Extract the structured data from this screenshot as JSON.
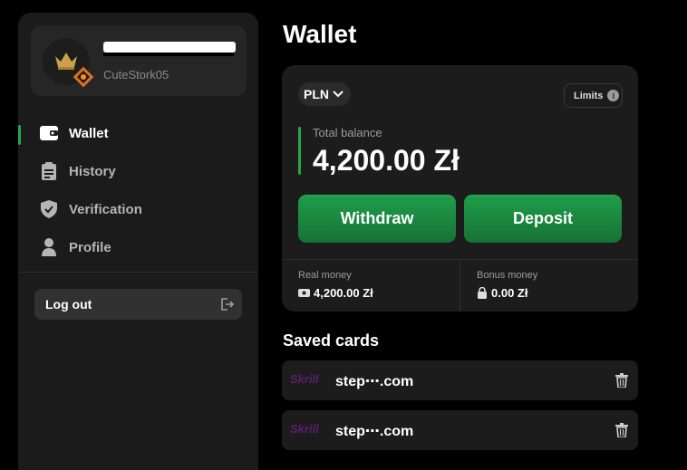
{
  "sidebar": {
    "profile": {
      "handle": "CuteStork05"
    },
    "items": [
      {
        "label": "Wallet",
        "icon": "wallet-icon",
        "active": true
      },
      {
        "label": "History",
        "icon": "clipboard-icon",
        "active": false
      },
      {
        "label": "Verification",
        "icon": "shield-check-icon",
        "active": false
      },
      {
        "label": "Profile",
        "icon": "user-icon",
        "active": false
      }
    ],
    "logout_label": "Log out"
  },
  "main": {
    "title": "Wallet",
    "currency": "PLN",
    "limits_label": "Limits",
    "balance_label": "Total balance",
    "balance_value": "4,200.00 Zł",
    "withdraw_label": "Withdraw",
    "deposit_label": "Deposit",
    "real_money_label": "Real money",
    "real_money_value": "4,200.00 Zł",
    "bonus_money_label": "Bonus money",
    "bonus_money_value": "0.00 Zł",
    "saved_cards_title": "Saved cards",
    "saved_cards": [
      {
        "brand": "Skrill",
        "email": "step⋯.com"
      },
      {
        "brand": "Skrill",
        "email": "step⋯.com"
      }
    ]
  },
  "colors": {
    "accent_green": "#28a745",
    "button_green": "#1f9e49",
    "skrill_purple": "#5a1e6e",
    "sidebar_bg": "#1b1b1b",
    "card_bg": "#1c1c1c"
  }
}
